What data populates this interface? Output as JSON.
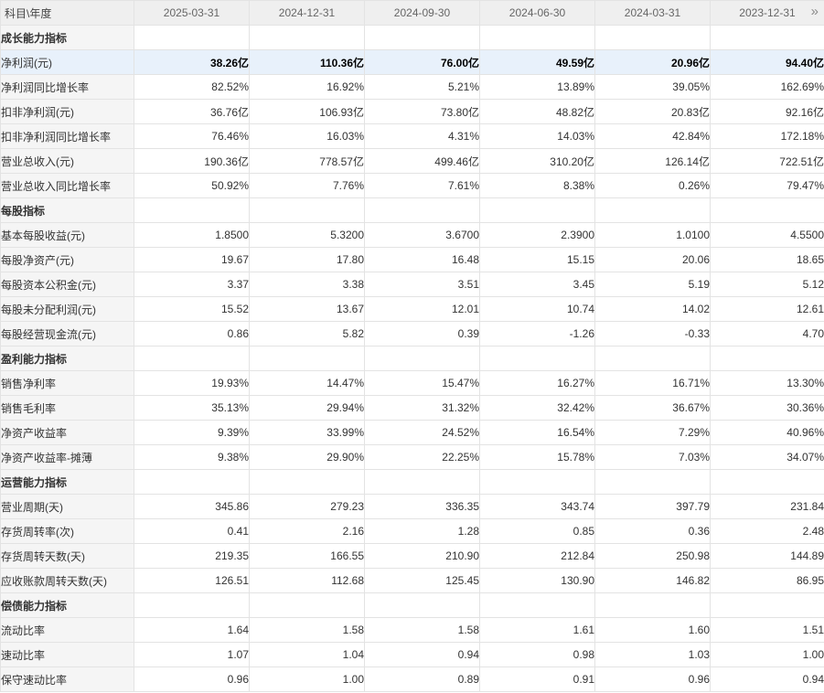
{
  "header": {
    "label": "科目\\年度",
    "periods": [
      "2025-03-31",
      "2024-12-31",
      "2024-09-30",
      "2024-06-30",
      "2024-03-31",
      "2023-12-31"
    ],
    "next_icon": "»"
  },
  "rows": [
    {
      "type": "section",
      "label": "成长能力指标"
    },
    {
      "type": "data",
      "label": "净利润(元)",
      "values": [
        "38.26亿",
        "110.36亿",
        "76.00亿",
        "49.59亿",
        "20.96亿",
        "94.40亿"
      ],
      "highlight": true
    },
    {
      "type": "data",
      "label": "净利润同比增长率",
      "values": [
        "82.52%",
        "16.92%",
        "5.21%",
        "13.89%",
        "39.05%",
        "162.69%"
      ]
    },
    {
      "type": "data",
      "label": "扣非净利润(元)",
      "values": [
        "36.76亿",
        "106.93亿",
        "73.80亿",
        "48.82亿",
        "20.83亿",
        "92.16亿"
      ]
    },
    {
      "type": "data",
      "label": "扣非净利润同比增长率",
      "values": [
        "76.46%",
        "16.03%",
        "4.31%",
        "14.03%",
        "42.84%",
        "172.18%"
      ]
    },
    {
      "type": "data",
      "label": "营业总收入(元)",
      "values": [
        "190.36亿",
        "778.57亿",
        "499.46亿",
        "310.20亿",
        "126.14亿",
        "722.51亿"
      ]
    },
    {
      "type": "data",
      "label": "营业总收入同比增长率",
      "values": [
        "50.92%",
        "7.76%",
        "7.61%",
        "8.38%",
        "0.26%",
        "79.47%"
      ]
    },
    {
      "type": "section",
      "label": "每股指标"
    },
    {
      "type": "data",
      "label": "基本每股收益(元)",
      "values": [
        "1.8500",
        "5.3200",
        "3.6700",
        "2.3900",
        "1.0100",
        "4.5500"
      ]
    },
    {
      "type": "data",
      "label": "每股净资产(元)",
      "values": [
        "19.67",
        "17.80",
        "16.48",
        "15.15",
        "20.06",
        "18.65"
      ]
    },
    {
      "type": "data",
      "label": "每股资本公积金(元)",
      "values": [
        "3.37",
        "3.38",
        "3.51",
        "3.45",
        "5.19",
        "5.12"
      ]
    },
    {
      "type": "data",
      "label": "每股未分配利润(元)",
      "values": [
        "15.52",
        "13.67",
        "12.01",
        "10.74",
        "14.02",
        "12.61"
      ]
    },
    {
      "type": "data",
      "label": "每股经营现金流(元)",
      "values": [
        "0.86",
        "5.82",
        "0.39",
        "-1.26",
        "-0.33",
        "4.70"
      ]
    },
    {
      "type": "section",
      "label": "盈利能力指标"
    },
    {
      "type": "data",
      "label": "销售净利率",
      "values": [
        "19.93%",
        "14.47%",
        "15.47%",
        "16.27%",
        "16.71%",
        "13.30%"
      ]
    },
    {
      "type": "data",
      "label": "销售毛利率",
      "values": [
        "35.13%",
        "29.94%",
        "31.32%",
        "32.42%",
        "36.67%",
        "30.36%"
      ]
    },
    {
      "type": "data",
      "label": "净资产收益率",
      "values": [
        "9.39%",
        "33.99%",
        "24.52%",
        "16.54%",
        "7.29%",
        "40.96%"
      ]
    },
    {
      "type": "data",
      "label": "净资产收益率-摊薄",
      "values": [
        "9.38%",
        "29.90%",
        "22.25%",
        "15.78%",
        "7.03%",
        "34.07%"
      ]
    },
    {
      "type": "section",
      "label": "运营能力指标"
    },
    {
      "type": "data",
      "label": "营业周期(天)",
      "values": [
        "345.86",
        "279.23",
        "336.35",
        "343.74",
        "397.79",
        "231.84"
      ]
    },
    {
      "type": "data",
      "label": "存货周转率(次)",
      "values": [
        "0.41",
        "2.16",
        "1.28",
        "0.85",
        "0.36",
        "2.48"
      ]
    },
    {
      "type": "data",
      "label": "存货周转天数(天)",
      "values": [
        "219.35",
        "166.55",
        "210.90",
        "212.84",
        "250.98",
        "144.89"
      ]
    },
    {
      "type": "data",
      "label": "应收账款周转天数(天)",
      "values": [
        "126.51",
        "112.68",
        "125.45",
        "130.90",
        "146.82",
        "86.95"
      ]
    },
    {
      "type": "section",
      "label": "偿债能力指标"
    },
    {
      "type": "data",
      "label": "流动比率",
      "values": [
        "1.64",
        "1.58",
        "1.58",
        "1.61",
        "1.60",
        "1.51"
      ]
    },
    {
      "type": "data",
      "label": "速动比率",
      "values": [
        "1.07",
        "1.04",
        "0.94",
        "0.98",
        "1.03",
        "1.00"
      ]
    },
    {
      "type": "data",
      "label": "保守速动比率",
      "values": [
        "0.96",
        "1.00",
        "0.89",
        "0.91",
        "0.96",
        "0.94"
      ]
    }
  ]
}
